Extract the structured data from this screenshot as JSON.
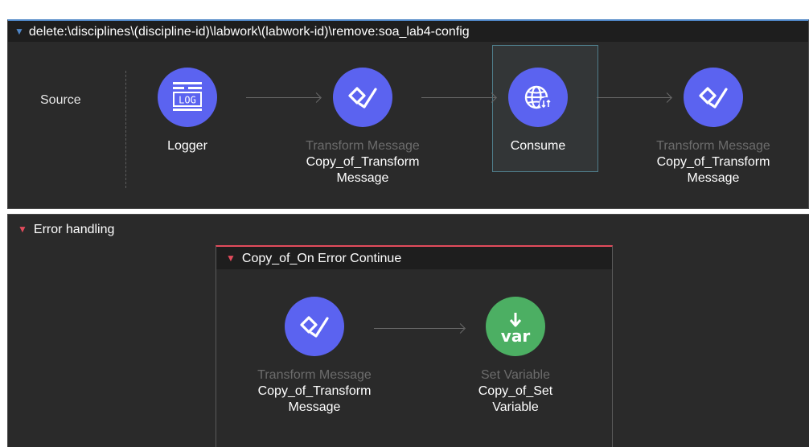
{
  "flow": {
    "title": "delete:\\disciplines\\(discipline-id)\\labwork\\(labwork-id)\\remove:soa_lab4-config",
    "source_label": "Source",
    "components": [
      {
        "type": "",
        "name_line1": "Logger",
        "name_line2": "",
        "icon": "logger-icon",
        "color": "#5b63f0"
      },
      {
        "type": "Transform Message",
        "name_line1": "Copy_of_Transform",
        "name_line2": "Message",
        "icon": "transform-message-icon",
        "color": "#5b63f0"
      },
      {
        "type": "",
        "name_line1": "Consume",
        "name_line2": "",
        "icon": "globe-consume-icon",
        "color": "#5b63f0",
        "selected": true
      },
      {
        "type": "Transform Message",
        "name_line1": "Copy_of_Transform",
        "name_line2": "Message",
        "icon": "transform-message-icon",
        "color": "#5b63f0"
      }
    ]
  },
  "error_handling": {
    "title": "Error handling",
    "on_error": {
      "title": "Copy_of_On Error Continue",
      "components": [
        {
          "type": "Transform Message",
          "name_line1": "Copy_of_Transform",
          "name_line2": "Message",
          "icon": "transform-message-icon",
          "color": "#5b63f0"
        },
        {
          "type": "Set Variable",
          "name_line1": "Copy_of_Set",
          "name_line2": "Variable",
          "icon": "set-variable-icon",
          "icon_text": "var",
          "color": "#4caf63"
        }
      ]
    }
  },
  "colors": {
    "flow_accent": "#4f86c6",
    "error_accent": "#e24b5c",
    "background": "#2a2a2a"
  }
}
